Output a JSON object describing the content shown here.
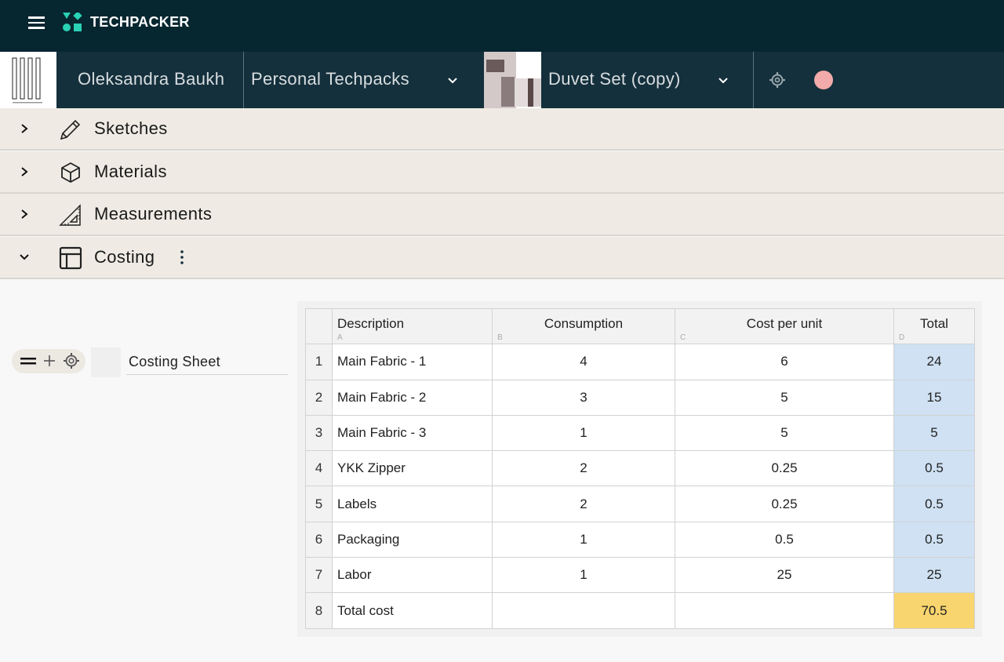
{
  "app": {
    "brand_name": "TECHPACKER",
    "brand_color": "#2ad1b4",
    "menu_icon": "hamburger-menu-icon"
  },
  "context_bar": {
    "owner_name": "Oleksandra Baukh",
    "folder_name": "Personal Techpacks",
    "product_name": "Duvet Set (copy)",
    "avatar_color": "#f2aaaa",
    "settings_icon": "gear-icon"
  },
  "sections": [
    {
      "label": "Sketches",
      "icon": "pencil-icon",
      "expanded": false
    },
    {
      "label": "Materials",
      "icon": "cube-icon",
      "expanded": false
    },
    {
      "label": "Measurements",
      "icon": "set-square-icon",
      "expanded": false
    },
    {
      "label": "Costing",
      "icon": "layout-icon",
      "expanded": true
    }
  ],
  "costing": {
    "sheet_name": "Costing Sheet",
    "columns": [
      {
        "letter": "A",
        "header": "Description"
      },
      {
        "letter": "B",
        "header": "Consumption"
      },
      {
        "letter": "C",
        "header": "Cost per unit"
      },
      {
        "letter": "D",
        "header": "Total"
      }
    ],
    "rows": [
      {
        "n": "1",
        "desc": "Main Fabric  - 1",
        "consumption": "4",
        "cost": "6",
        "total": "24"
      },
      {
        "n": "2",
        "desc": "Main Fabric - 2",
        "consumption": "3",
        "cost": "5",
        "total": "15"
      },
      {
        "n": "3",
        "desc": "Main Fabric - 3",
        "consumption": "1",
        "cost": "5",
        "total": "5"
      },
      {
        "n": "4",
        "desc": "YKK Zipper",
        "consumption": "2",
        "cost": "0.25",
        "total": "0.5"
      },
      {
        "n": "5",
        "desc": "Labels",
        "consumption": "2",
        "cost": "0.25",
        "total": "0.5"
      },
      {
        "n": "6",
        "desc": "Packaging",
        "consumption": "1",
        "cost": "0.5",
        "total": "0.5"
      },
      {
        "n": "7",
        "desc": "Labor",
        "consumption": "1",
        "cost": "25",
        "total": "25"
      },
      {
        "n": "8",
        "desc": "Total cost",
        "consumption": "",
        "cost": "",
        "total": "70.5"
      }
    ],
    "total_highlight_color": "#f8d56e",
    "formula_cell_color": "#cfe1f3"
  }
}
